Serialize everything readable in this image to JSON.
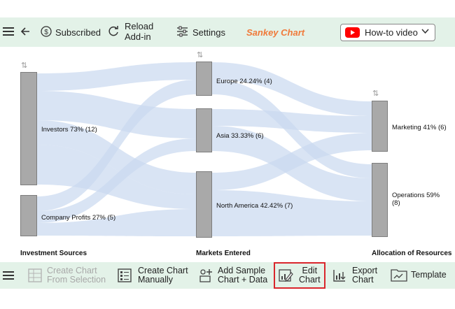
{
  "toolbar": {
    "subscribed_label": "Subscribed",
    "reload_label_line1": "Reload",
    "reload_label_line2": "Add-in",
    "settings_label": "Settings",
    "app_title": "Sankey Chart",
    "howto_label": "How-to video"
  },
  "chart": {
    "columns": [
      "Investment Sources",
      "Markets Entered",
      "Allocation of Resources"
    ],
    "nodes": {
      "investors": "Investors 73% (12)",
      "company_profits": "Company Profits 27% (5)",
      "europe": "Europe 24.24% (4)",
      "asia": "Asia 33.33% (6)",
      "north_america": "North America 42.42% (7)",
      "marketing": "Marketing 41% (6)",
      "operations_line1": "Operations 59%",
      "operations_line2": "(8)"
    }
  },
  "bottom_toolbar": {
    "create_selection_l1": "Create Chart",
    "create_selection_l2": "From Selection",
    "create_manual_l1": "Create Chart",
    "create_manual_l2": "Manually",
    "add_sample_l1": "Add Sample",
    "add_sample_l2": "Chart + Data",
    "edit_l1": "Edit",
    "edit_l2": "Chart",
    "export_l1": "Export",
    "export_l2": "Chart",
    "template_label": "Template"
  },
  "colors": {
    "toolbar_bg": "#e3f2e8",
    "accent_title": "#f07a3a",
    "node_fill": "#a9a9a9",
    "flow_fill": "#c9d9ef",
    "highlight": "#d9262c"
  }
}
